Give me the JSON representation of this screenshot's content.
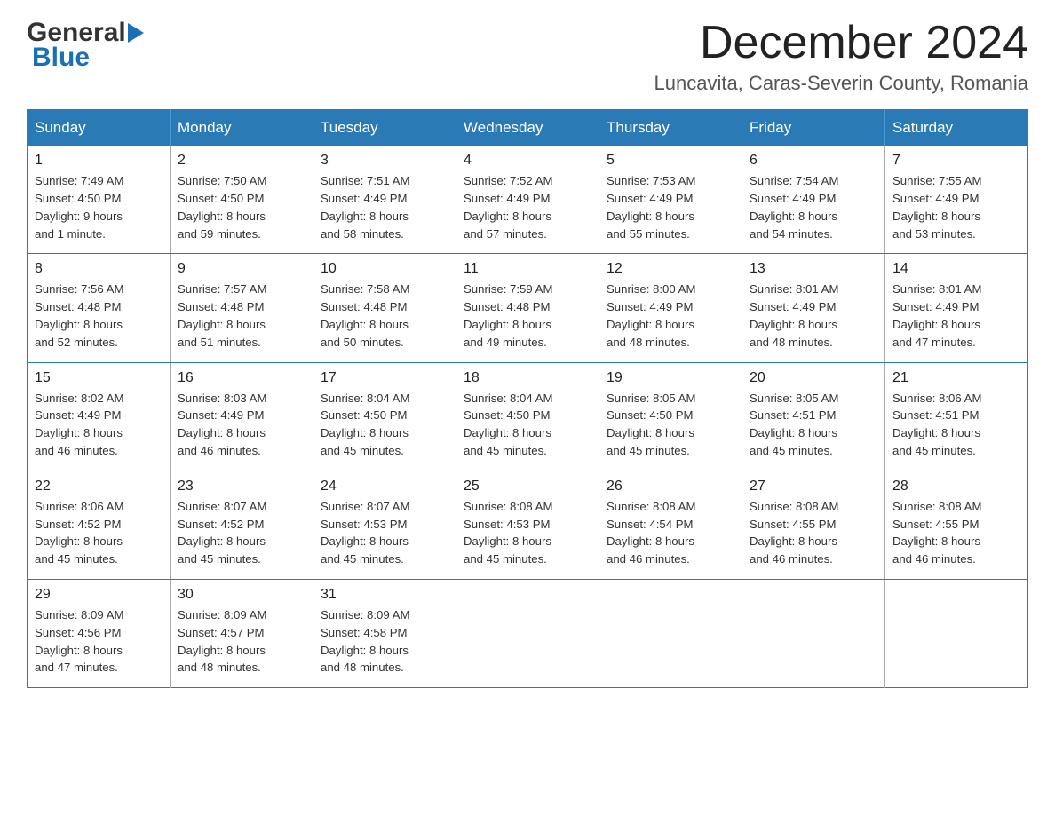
{
  "header": {
    "month_title": "December 2024",
    "location": "Luncavita, Caras-Severin County, Romania",
    "logo_text_1": "General",
    "logo_text_2": "Blue"
  },
  "weekdays": [
    "Sunday",
    "Monday",
    "Tuesday",
    "Wednesday",
    "Thursday",
    "Friday",
    "Saturday"
  ],
  "weeks": [
    [
      {
        "day": "1",
        "info": "Sunrise: 7:49 AM\nSunset: 4:50 PM\nDaylight: 9 hours\nand 1 minute."
      },
      {
        "day": "2",
        "info": "Sunrise: 7:50 AM\nSunset: 4:50 PM\nDaylight: 8 hours\nand 59 minutes."
      },
      {
        "day": "3",
        "info": "Sunrise: 7:51 AM\nSunset: 4:49 PM\nDaylight: 8 hours\nand 58 minutes."
      },
      {
        "day": "4",
        "info": "Sunrise: 7:52 AM\nSunset: 4:49 PM\nDaylight: 8 hours\nand 57 minutes."
      },
      {
        "day": "5",
        "info": "Sunrise: 7:53 AM\nSunset: 4:49 PM\nDaylight: 8 hours\nand 55 minutes."
      },
      {
        "day": "6",
        "info": "Sunrise: 7:54 AM\nSunset: 4:49 PM\nDaylight: 8 hours\nand 54 minutes."
      },
      {
        "day": "7",
        "info": "Sunrise: 7:55 AM\nSunset: 4:49 PM\nDaylight: 8 hours\nand 53 minutes."
      }
    ],
    [
      {
        "day": "8",
        "info": "Sunrise: 7:56 AM\nSunset: 4:48 PM\nDaylight: 8 hours\nand 52 minutes."
      },
      {
        "day": "9",
        "info": "Sunrise: 7:57 AM\nSunset: 4:48 PM\nDaylight: 8 hours\nand 51 minutes."
      },
      {
        "day": "10",
        "info": "Sunrise: 7:58 AM\nSunset: 4:48 PM\nDaylight: 8 hours\nand 50 minutes."
      },
      {
        "day": "11",
        "info": "Sunrise: 7:59 AM\nSunset: 4:48 PM\nDaylight: 8 hours\nand 49 minutes."
      },
      {
        "day": "12",
        "info": "Sunrise: 8:00 AM\nSunset: 4:49 PM\nDaylight: 8 hours\nand 48 minutes."
      },
      {
        "day": "13",
        "info": "Sunrise: 8:01 AM\nSunset: 4:49 PM\nDaylight: 8 hours\nand 48 minutes."
      },
      {
        "day": "14",
        "info": "Sunrise: 8:01 AM\nSunset: 4:49 PM\nDaylight: 8 hours\nand 47 minutes."
      }
    ],
    [
      {
        "day": "15",
        "info": "Sunrise: 8:02 AM\nSunset: 4:49 PM\nDaylight: 8 hours\nand 46 minutes."
      },
      {
        "day": "16",
        "info": "Sunrise: 8:03 AM\nSunset: 4:49 PM\nDaylight: 8 hours\nand 46 minutes."
      },
      {
        "day": "17",
        "info": "Sunrise: 8:04 AM\nSunset: 4:50 PM\nDaylight: 8 hours\nand 45 minutes."
      },
      {
        "day": "18",
        "info": "Sunrise: 8:04 AM\nSunset: 4:50 PM\nDaylight: 8 hours\nand 45 minutes."
      },
      {
        "day": "19",
        "info": "Sunrise: 8:05 AM\nSunset: 4:50 PM\nDaylight: 8 hours\nand 45 minutes."
      },
      {
        "day": "20",
        "info": "Sunrise: 8:05 AM\nSunset: 4:51 PM\nDaylight: 8 hours\nand 45 minutes."
      },
      {
        "day": "21",
        "info": "Sunrise: 8:06 AM\nSunset: 4:51 PM\nDaylight: 8 hours\nand 45 minutes."
      }
    ],
    [
      {
        "day": "22",
        "info": "Sunrise: 8:06 AM\nSunset: 4:52 PM\nDaylight: 8 hours\nand 45 minutes."
      },
      {
        "day": "23",
        "info": "Sunrise: 8:07 AM\nSunset: 4:52 PM\nDaylight: 8 hours\nand 45 minutes."
      },
      {
        "day": "24",
        "info": "Sunrise: 8:07 AM\nSunset: 4:53 PM\nDaylight: 8 hours\nand 45 minutes."
      },
      {
        "day": "25",
        "info": "Sunrise: 8:08 AM\nSunset: 4:53 PM\nDaylight: 8 hours\nand 45 minutes."
      },
      {
        "day": "26",
        "info": "Sunrise: 8:08 AM\nSunset: 4:54 PM\nDaylight: 8 hours\nand 46 minutes."
      },
      {
        "day": "27",
        "info": "Sunrise: 8:08 AM\nSunset: 4:55 PM\nDaylight: 8 hours\nand 46 minutes."
      },
      {
        "day": "28",
        "info": "Sunrise: 8:08 AM\nSunset: 4:55 PM\nDaylight: 8 hours\nand 46 minutes."
      }
    ],
    [
      {
        "day": "29",
        "info": "Sunrise: 8:09 AM\nSunset: 4:56 PM\nDaylight: 8 hours\nand 47 minutes."
      },
      {
        "day": "30",
        "info": "Sunrise: 8:09 AM\nSunset: 4:57 PM\nDaylight: 8 hours\nand 48 minutes."
      },
      {
        "day": "31",
        "info": "Sunrise: 8:09 AM\nSunset: 4:58 PM\nDaylight: 8 hours\nand 48 minutes."
      },
      {
        "day": "",
        "info": ""
      },
      {
        "day": "",
        "info": ""
      },
      {
        "day": "",
        "info": ""
      },
      {
        "day": "",
        "info": ""
      }
    ]
  ]
}
